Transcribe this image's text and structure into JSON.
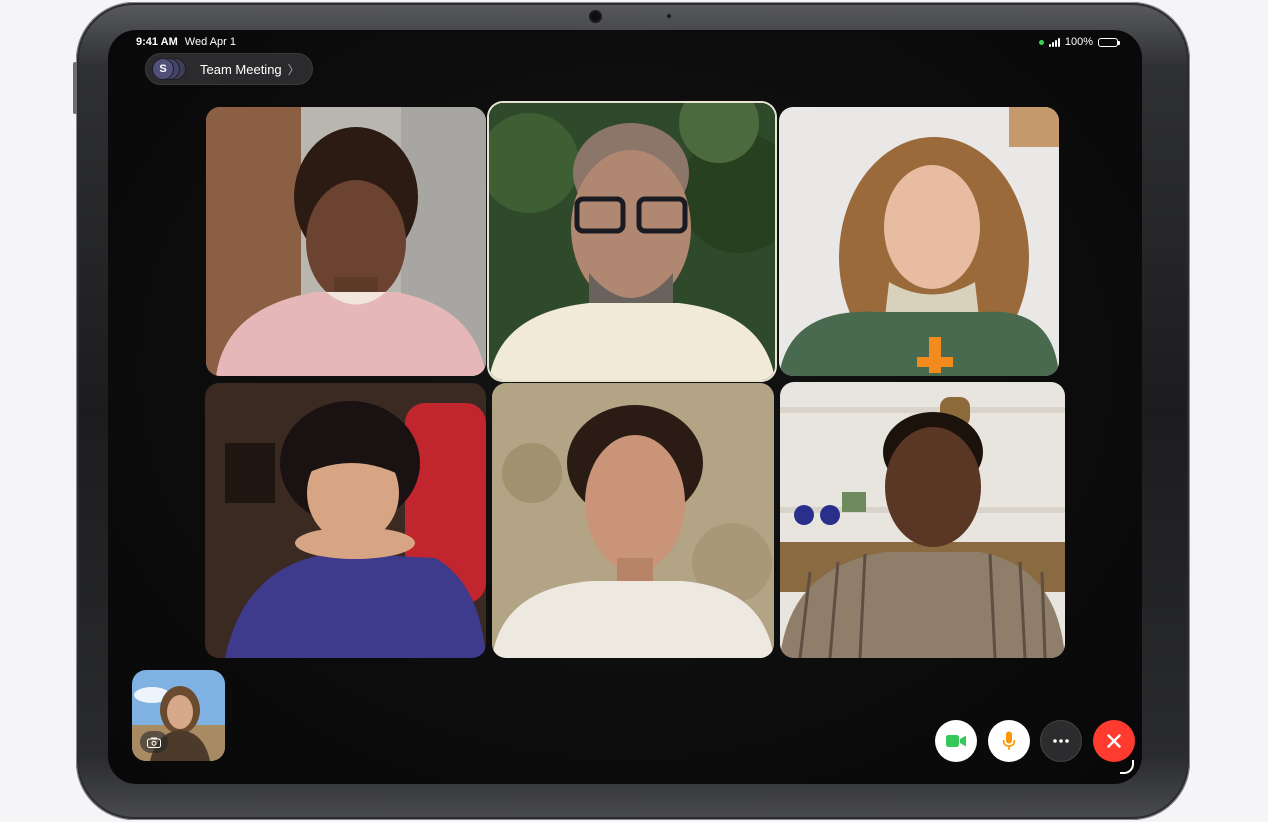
{
  "status_bar": {
    "time": "9:41 AM",
    "date": "Wed Apr 1",
    "battery": "100%"
  },
  "group": {
    "name": "Team Meeting",
    "avatar_initial": "S",
    "chevron": "〉"
  },
  "tiles": [
    {
      "name": "participant-1",
      "active": false
    },
    {
      "name": "participant-2",
      "active": true
    },
    {
      "name": "participant-3",
      "active": false
    },
    {
      "name": "participant-4",
      "active": false
    },
    {
      "name": "participant-5",
      "active": false
    },
    {
      "name": "participant-6",
      "active": false
    }
  ],
  "controls": {
    "video_icon": "video-camera-icon",
    "mic_icon": "microphone-icon",
    "more_icon": "ellipsis-icon",
    "end_icon": "close-icon"
  },
  "colors": {
    "video_green": "#34c759",
    "mic_orange": "#ff9500",
    "end_red": "#ff3b30",
    "status_green": "#32d74b"
  }
}
